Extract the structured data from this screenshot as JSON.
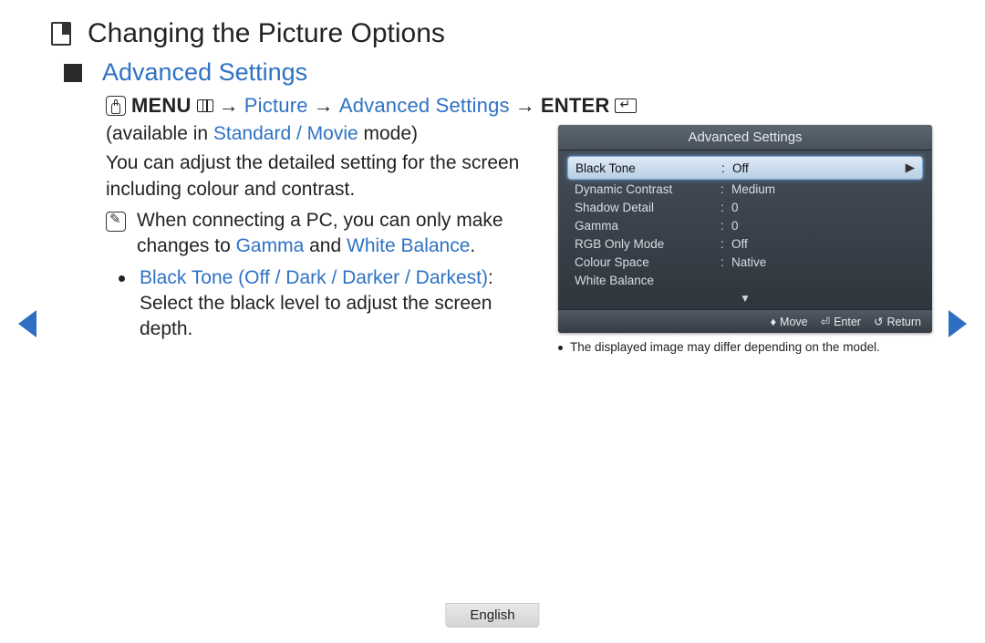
{
  "page": {
    "title": "Changing the Picture Options",
    "section": "Advanced Settings"
  },
  "nav": {
    "menu": "MENU",
    "path1": "Picture",
    "path2": "Advanced Settings",
    "enter": "ENTER",
    "arrow": "→"
  },
  "body": {
    "available_prefix": "(available in ",
    "available_modes": "Standard / Movie",
    "available_suffix": " mode)",
    "intro": "You can adjust the detailed setting for the screen including colour and contrast.",
    "note_prefix": "When connecting a PC, you can only make changes to ",
    "note_link1": "Gamma",
    "note_and": " and ",
    "note_link2": "White Balance",
    "note_period": ".",
    "bullet_label": "Black Tone (Off / Dark / Darker / Darkest)",
    "bullet_desc": ": Select the black level to adjust the screen depth."
  },
  "osd": {
    "title": "Advanced Settings",
    "items": [
      {
        "label": "Black Tone",
        "value": "Off",
        "highlight": true
      },
      {
        "label": "Dynamic Contrast",
        "value": "Medium"
      },
      {
        "label": "Shadow Detail",
        "value": "0"
      },
      {
        "label": "Gamma",
        "value": "0"
      },
      {
        "label": "RGB Only Mode",
        "value": "Off"
      },
      {
        "label": "Colour Space",
        "value": "Native"
      },
      {
        "label": "White Balance",
        "value": ""
      }
    ],
    "more": "▼",
    "footer": {
      "move_icon": "♦",
      "move": "Move",
      "enter_icon": "⏎",
      "enter": "Enter",
      "return_icon": "↺",
      "return": "Return"
    },
    "caption": "The displayed image may differ depending on the model."
  },
  "footer": {
    "language": "English"
  }
}
